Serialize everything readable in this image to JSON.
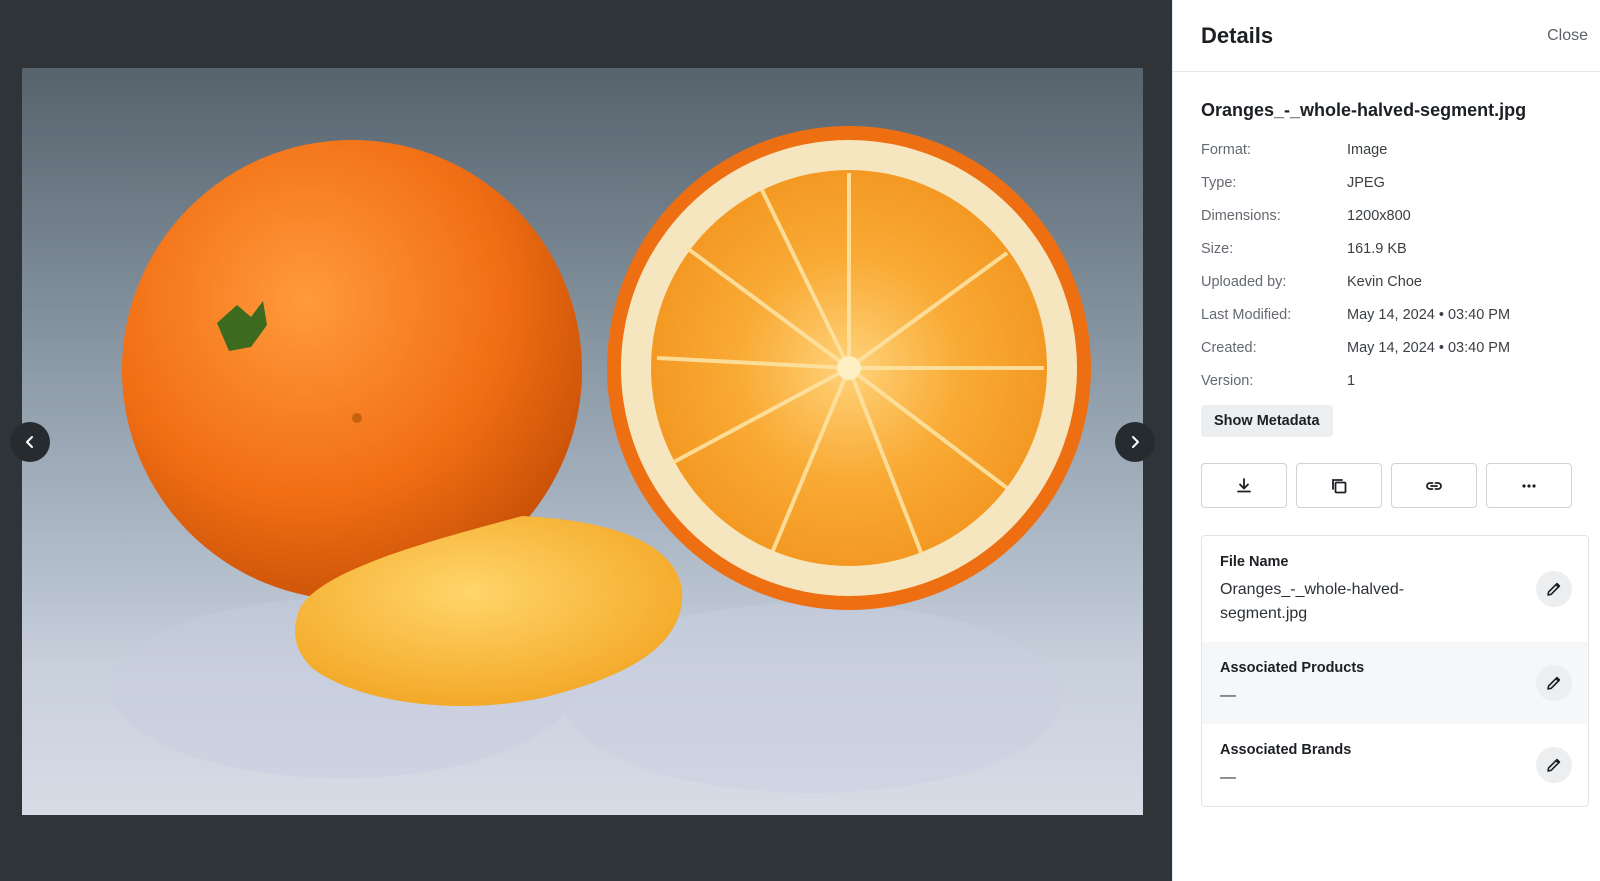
{
  "panel": {
    "title": "Details",
    "close_label": "Close"
  },
  "file": {
    "title": "Oranges_-_whole-halved-segment.jpg",
    "metadata": [
      {
        "label": "Format:",
        "value": "Image"
      },
      {
        "label": "Type:",
        "value": "JPEG"
      },
      {
        "label": "Dimensions:",
        "value": "1200x800"
      },
      {
        "label": "Size:",
        "value": "161.9 KB"
      },
      {
        "label": "Uploaded by:",
        "value": "Kevin Choe"
      },
      {
        "label": "Last Modified:",
        "value": "May 14, 2024 • 03:40 PM"
      },
      {
        "label": "Created:",
        "value": "May 14, 2024 • 03:40 PM"
      },
      {
        "label": "Version:",
        "value": "1"
      }
    ],
    "show_metadata_label": "Show Metadata"
  },
  "actions": [
    {
      "icon": "download-icon"
    },
    {
      "icon": "copy-icon"
    },
    {
      "icon": "link-icon"
    },
    {
      "icon": "more-icon"
    }
  ],
  "info": {
    "file_name": {
      "label": "File Name",
      "value": "Oranges_-_whole-halved-segment.jpg"
    },
    "associated_products": {
      "label": "Associated Products",
      "value": "—"
    },
    "associated_brands": {
      "label": "Associated Brands",
      "value": "—"
    }
  },
  "viewer": {
    "image_subject": "whole orange, halved orange and orange segment on grey background",
    "colors": {
      "backdrop": "#2e3438",
      "orange_peel": "#f07a1e",
      "orange_flesh": "#f7a52a"
    }
  }
}
